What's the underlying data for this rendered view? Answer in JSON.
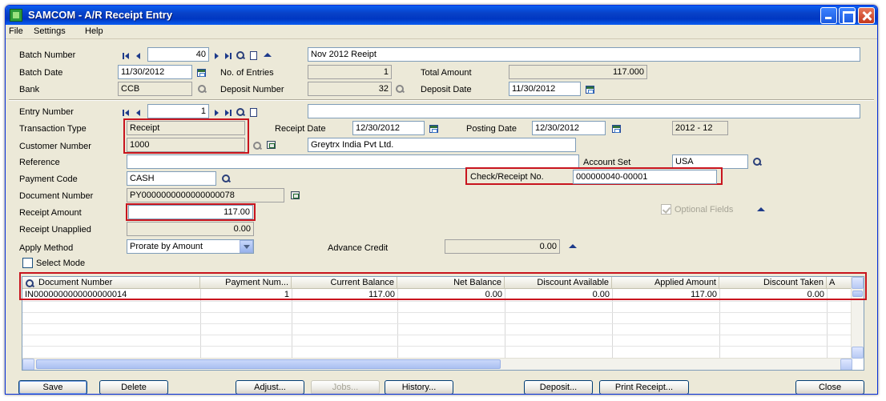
{
  "window": {
    "title": "SAMCOM - A/R Receipt Entry"
  },
  "menu": [
    "File",
    "Settings",
    "Help"
  ],
  "batch": {
    "number_label": "Batch Number",
    "number": "40",
    "description": "Nov 2012 Reeipt",
    "date_label": "Batch Date",
    "date": "11/30/2012",
    "entries_label": "No. of Entries",
    "entries": "1",
    "total_label": "Total Amount",
    "total": "117.000",
    "bank_label": "Bank",
    "bank": "CCB",
    "deposit_number_label": "Deposit Number",
    "deposit_number": "32",
    "deposit_date_label": "Deposit Date",
    "deposit_date": "11/30/2012"
  },
  "entry": {
    "number_label": "Entry Number",
    "number": "1",
    "description": "",
    "transaction_type_label": "Transaction Type",
    "transaction_type": "Receipt",
    "receipt_date_label": "Receipt Date",
    "receipt_date": "12/30/2012",
    "posting_date_label": "Posting Date",
    "posting_date": "12/30/2012",
    "period": "2012 - 12",
    "customer_number_label": "Customer Number",
    "customer_number": "1000",
    "customer_name": "Greytrx India Pvt Ltd.",
    "reference_label": "Reference",
    "reference": "",
    "account_set_label": "Account Set",
    "account_set": "USA",
    "payment_code_label": "Payment Code",
    "payment_code": "CASH",
    "check_label": "Check/Receipt No.",
    "check_no": "000000040-00001",
    "document_number_label": "Document Number",
    "document_number": "PY0000000000000000078",
    "receipt_amount_label": "Receipt Amount",
    "receipt_amount": "117.00",
    "optional_fields_label": "Optional Fields",
    "receipt_unapplied_label": "Receipt Unapplied",
    "receipt_unapplied": "0.00",
    "apply_method_label": "Apply Method",
    "apply_method": "Prorate by Amount",
    "advance_credit_label": "Advance Credit",
    "advance_credit": "0.00",
    "select_mode_label": "Select Mode"
  },
  "grid": {
    "headers": [
      "Document Number",
      "Payment Num...",
      "Current Balance",
      "Net Balance",
      "Discount Available",
      "Applied Amount",
      "Discount Taken",
      "A"
    ],
    "rows": [
      [
        "IN0000000000000000014",
        "1",
        "117.00",
        "0.00",
        "0.00",
        "117.00",
        "0.00"
      ]
    ]
  },
  "buttons": {
    "save": "Save",
    "delete": "Delete",
    "adjust": "Adjust...",
    "jobs": "Jobs...",
    "history": "History...",
    "deposit": "Deposit...",
    "print_receipt": "Print Receipt...",
    "close": "Close"
  },
  "colors": {
    "titlebar": "#0a5df2",
    "highlight": "#c8141e",
    "face": "#ece9d8"
  }
}
